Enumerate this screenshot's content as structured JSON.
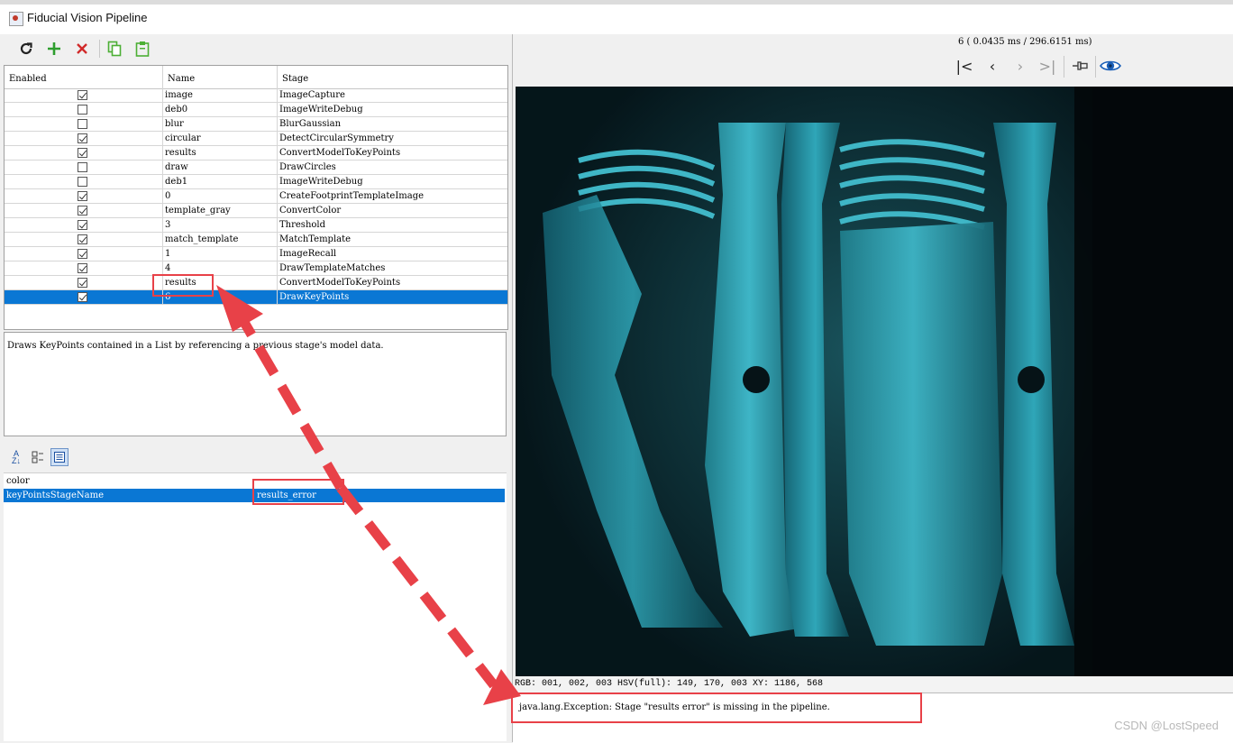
{
  "window": {
    "title": "Fiducial Vision Pipeline"
  },
  "toolbar": {
    "icons": [
      "refresh-icon",
      "add-icon",
      "delete-icon",
      "copy-icon",
      "paste-icon"
    ],
    "colors": {
      "add": "#2e9e2e",
      "delete": "#d12a2a",
      "copy": "#4caf34",
      "paste": "#4caf34"
    }
  },
  "table": {
    "headers": {
      "enabled": "Enabled",
      "name": "Name",
      "stage": "Stage"
    },
    "rows": [
      {
        "enabled": true,
        "name": "image",
        "stage": "ImageCapture"
      },
      {
        "enabled": false,
        "name": "deb0",
        "stage": "ImageWriteDebug"
      },
      {
        "enabled": false,
        "name": "blur",
        "stage": "BlurGaussian"
      },
      {
        "enabled": true,
        "name": "circular",
        "stage": "DetectCircularSymmetry"
      },
      {
        "enabled": true,
        "name": "results",
        "stage": "ConvertModelToKeyPoints"
      },
      {
        "enabled": false,
        "name": "draw",
        "stage": "DrawCircles"
      },
      {
        "enabled": false,
        "name": "deb1",
        "stage": "ImageWriteDebug"
      },
      {
        "enabled": true,
        "name": "0",
        "stage": "CreateFootprintTemplateImage"
      },
      {
        "enabled": true,
        "name": "template_gray",
        "stage": "ConvertColor"
      },
      {
        "enabled": true,
        "name": "3",
        "stage": "Threshold"
      },
      {
        "enabled": true,
        "name": "match_template",
        "stage": "MatchTemplate"
      },
      {
        "enabled": true,
        "name": "1",
        "stage": "ImageRecall"
      },
      {
        "enabled": true,
        "name": "4",
        "stage": "DrawTemplateMatches"
      },
      {
        "enabled": true,
        "name": "results",
        "stage": "ConvertModelToKeyPoints"
      },
      {
        "enabled": true,
        "name": "6",
        "stage": "DrawKeyPoints",
        "selected": true
      }
    ]
  },
  "description": "Draws KeyPoints contained in a List by referencing a previous stage's model data.",
  "properties": {
    "toolbar_icons": [
      "sort-alphabetical-icon",
      "categorized-icon",
      "description-toggle-icon"
    ],
    "rows": [
      {
        "key": "color",
        "value": ""
      },
      {
        "key": "keyPointsStageName",
        "value": "results_error",
        "selected": true
      }
    ]
  },
  "viewer": {
    "status": "6 ( 0.0435 ms / 296.6151 ms)",
    "nav_icons": [
      "first-icon",
      "previous-icon",
      "next-icon",
      "last-icon",
      "pin-icon",
      "eye-icon"
    ],
    "pixel_info": "RGB: 001, 002, 003 HSV(full): 149, 170, 003 XY: 1186, 568",
    "error": "java.lang.Exception: Stage \"results error\" is missing in the pipeline."
  },
  "watermark": "CSDN @LostSpeed",
  "colors": {
    "selection": "#0a77d4",
    "annotation": "#e84148",
    "image_tint": "#2fa6b8"
  }
}
